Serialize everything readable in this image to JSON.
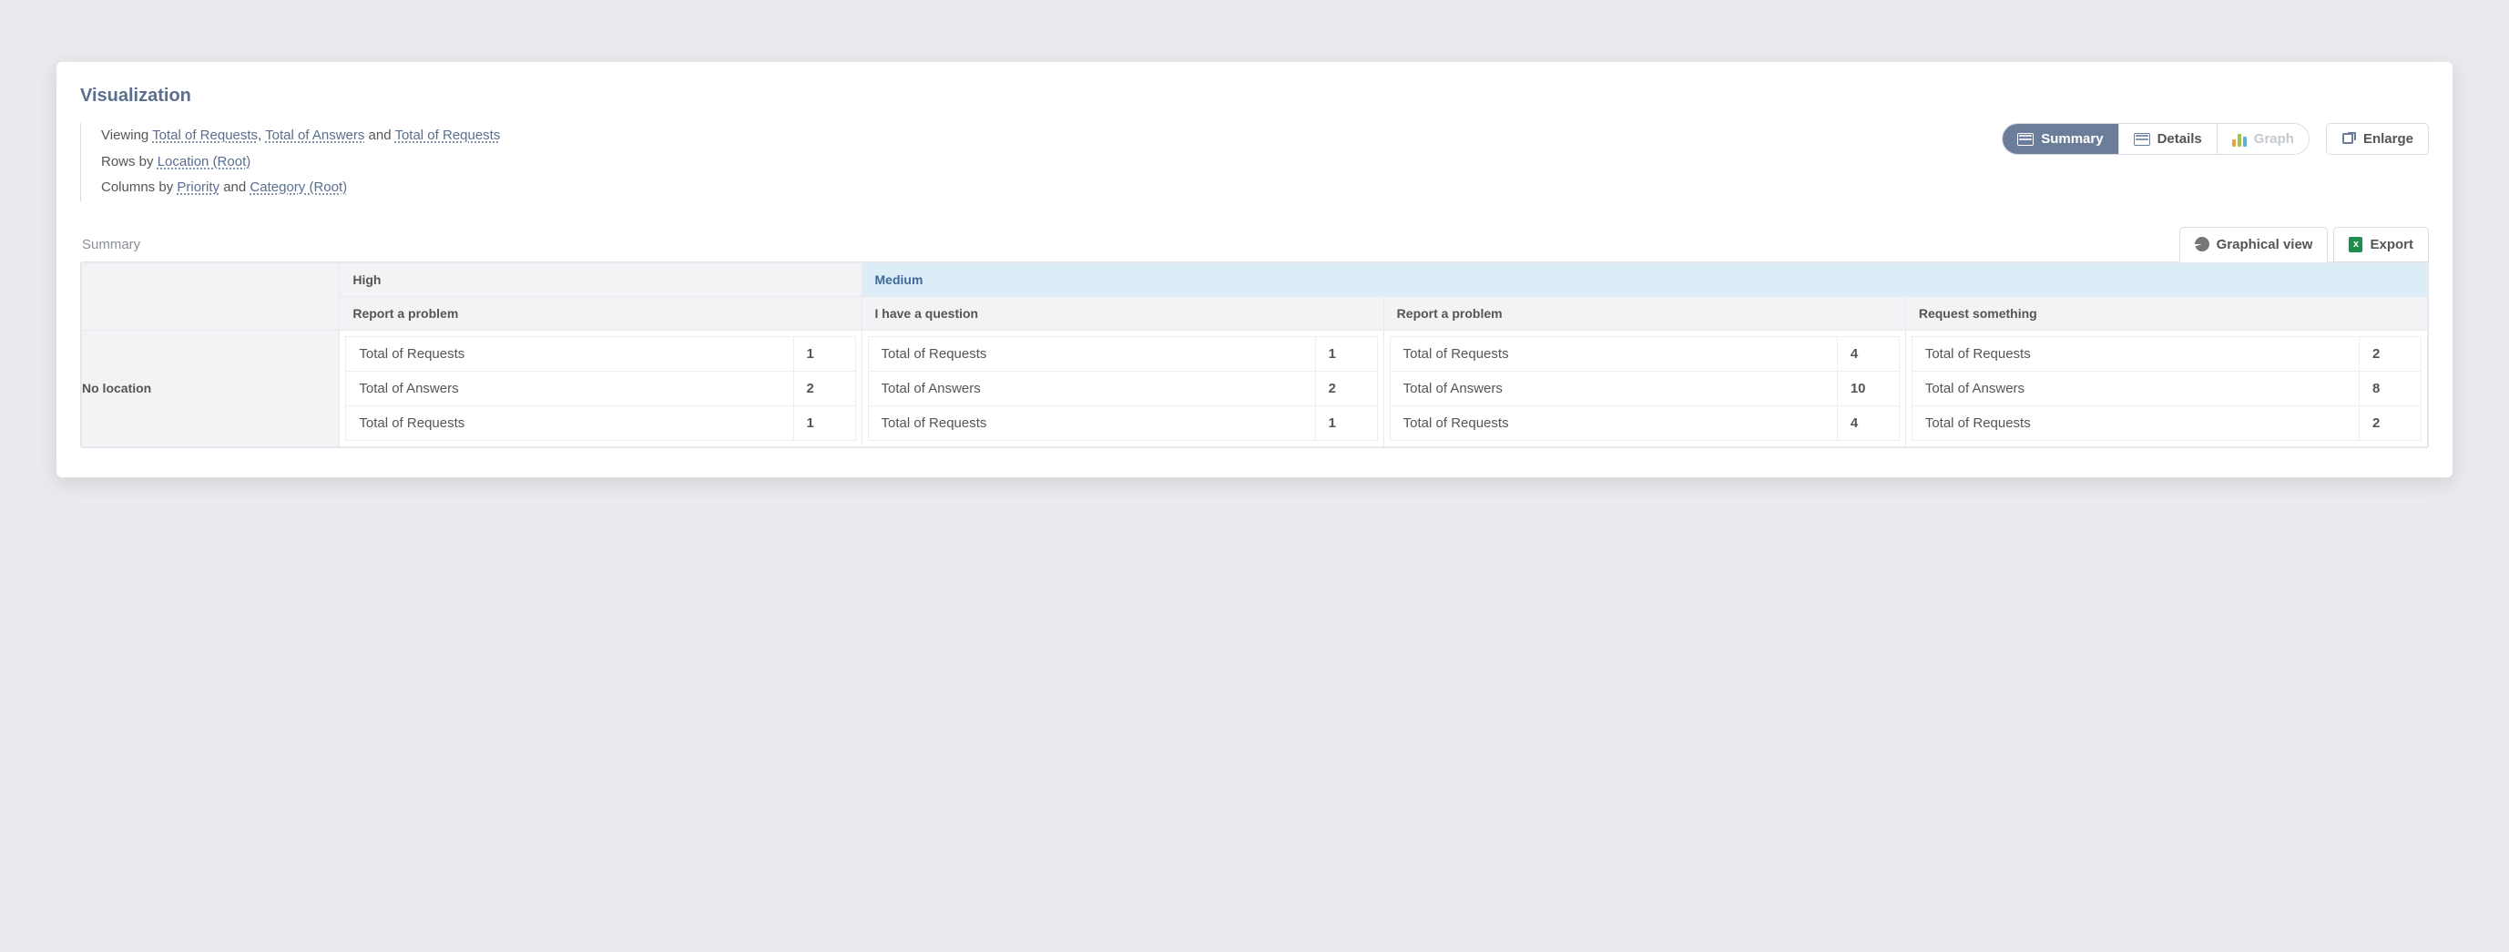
{
  "panel": {
    "title": "Visualization"
  },
  "desc": {
    "viewing_prefix": "Viewing ",
    "m1": "Total of Requests",
    "sep_comma": ", ",
    "m2": "Total of Answers",
    "sep_and": " and ",
    "m3": "Total of Requests",
    "rows_prefix": "Rows by ",
    "rows_link": "Location (Root)",
    "cols_prefix": "Columns by ",
    "cols_link1": "Priority",
    "cols_and": " and ",
    "cols_link2": "Category (Root)"
  },
  "tabs": {
    "view_summary": "Summary",
    "view_details": "Details",
    "view_graph": "Graph",
    "enlarge": "Enlarge"
  },
  "section": {
    "label": "Summary",
    "graphical_view": "Graphical view",
    "export": "Export"
  },
  "table": {
    "priority_high": "High",
    "priority_medium": "Medium",
    "cat_high_0": "Report a problem",
    "cat_med_0": "I have a question",
    "cat_med_1": "Report a problem",
    "cat_med_2": "Request something",
    "row_label": "No location",
    "metric_requests": "Total of Requests",
    "metric_answers": "Total of Answers",
    "metric_requests2": "Total of Requests",
    "cells": {
      "c0": {
        "r": "1",
        "a": "2",
        "r2": "1"
      },
      "c1": {
        "r": "1",
        "a": "2",
        "r2": "1"
      },
      "c2": {
        "r": "4",
        "a": "10",
        "r2": "4"
      },
      "c3": {
        "r": "2",
        "a": "8",
        "r2": "2"
      }
    }
  }
}
